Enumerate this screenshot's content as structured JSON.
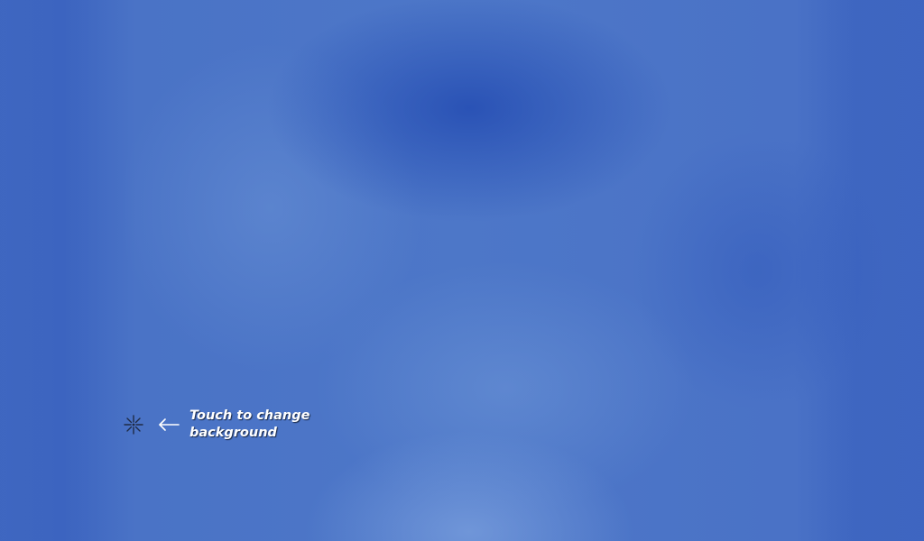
{
  "desktop": {
    "background_color": "#3f66c2",
    "hint": {
      "icon": "crosshair-sparkle-icon",
      "arrow_icon": "arrow-left-icon",
      "label": "Touch to change background"
    }
  }
}
